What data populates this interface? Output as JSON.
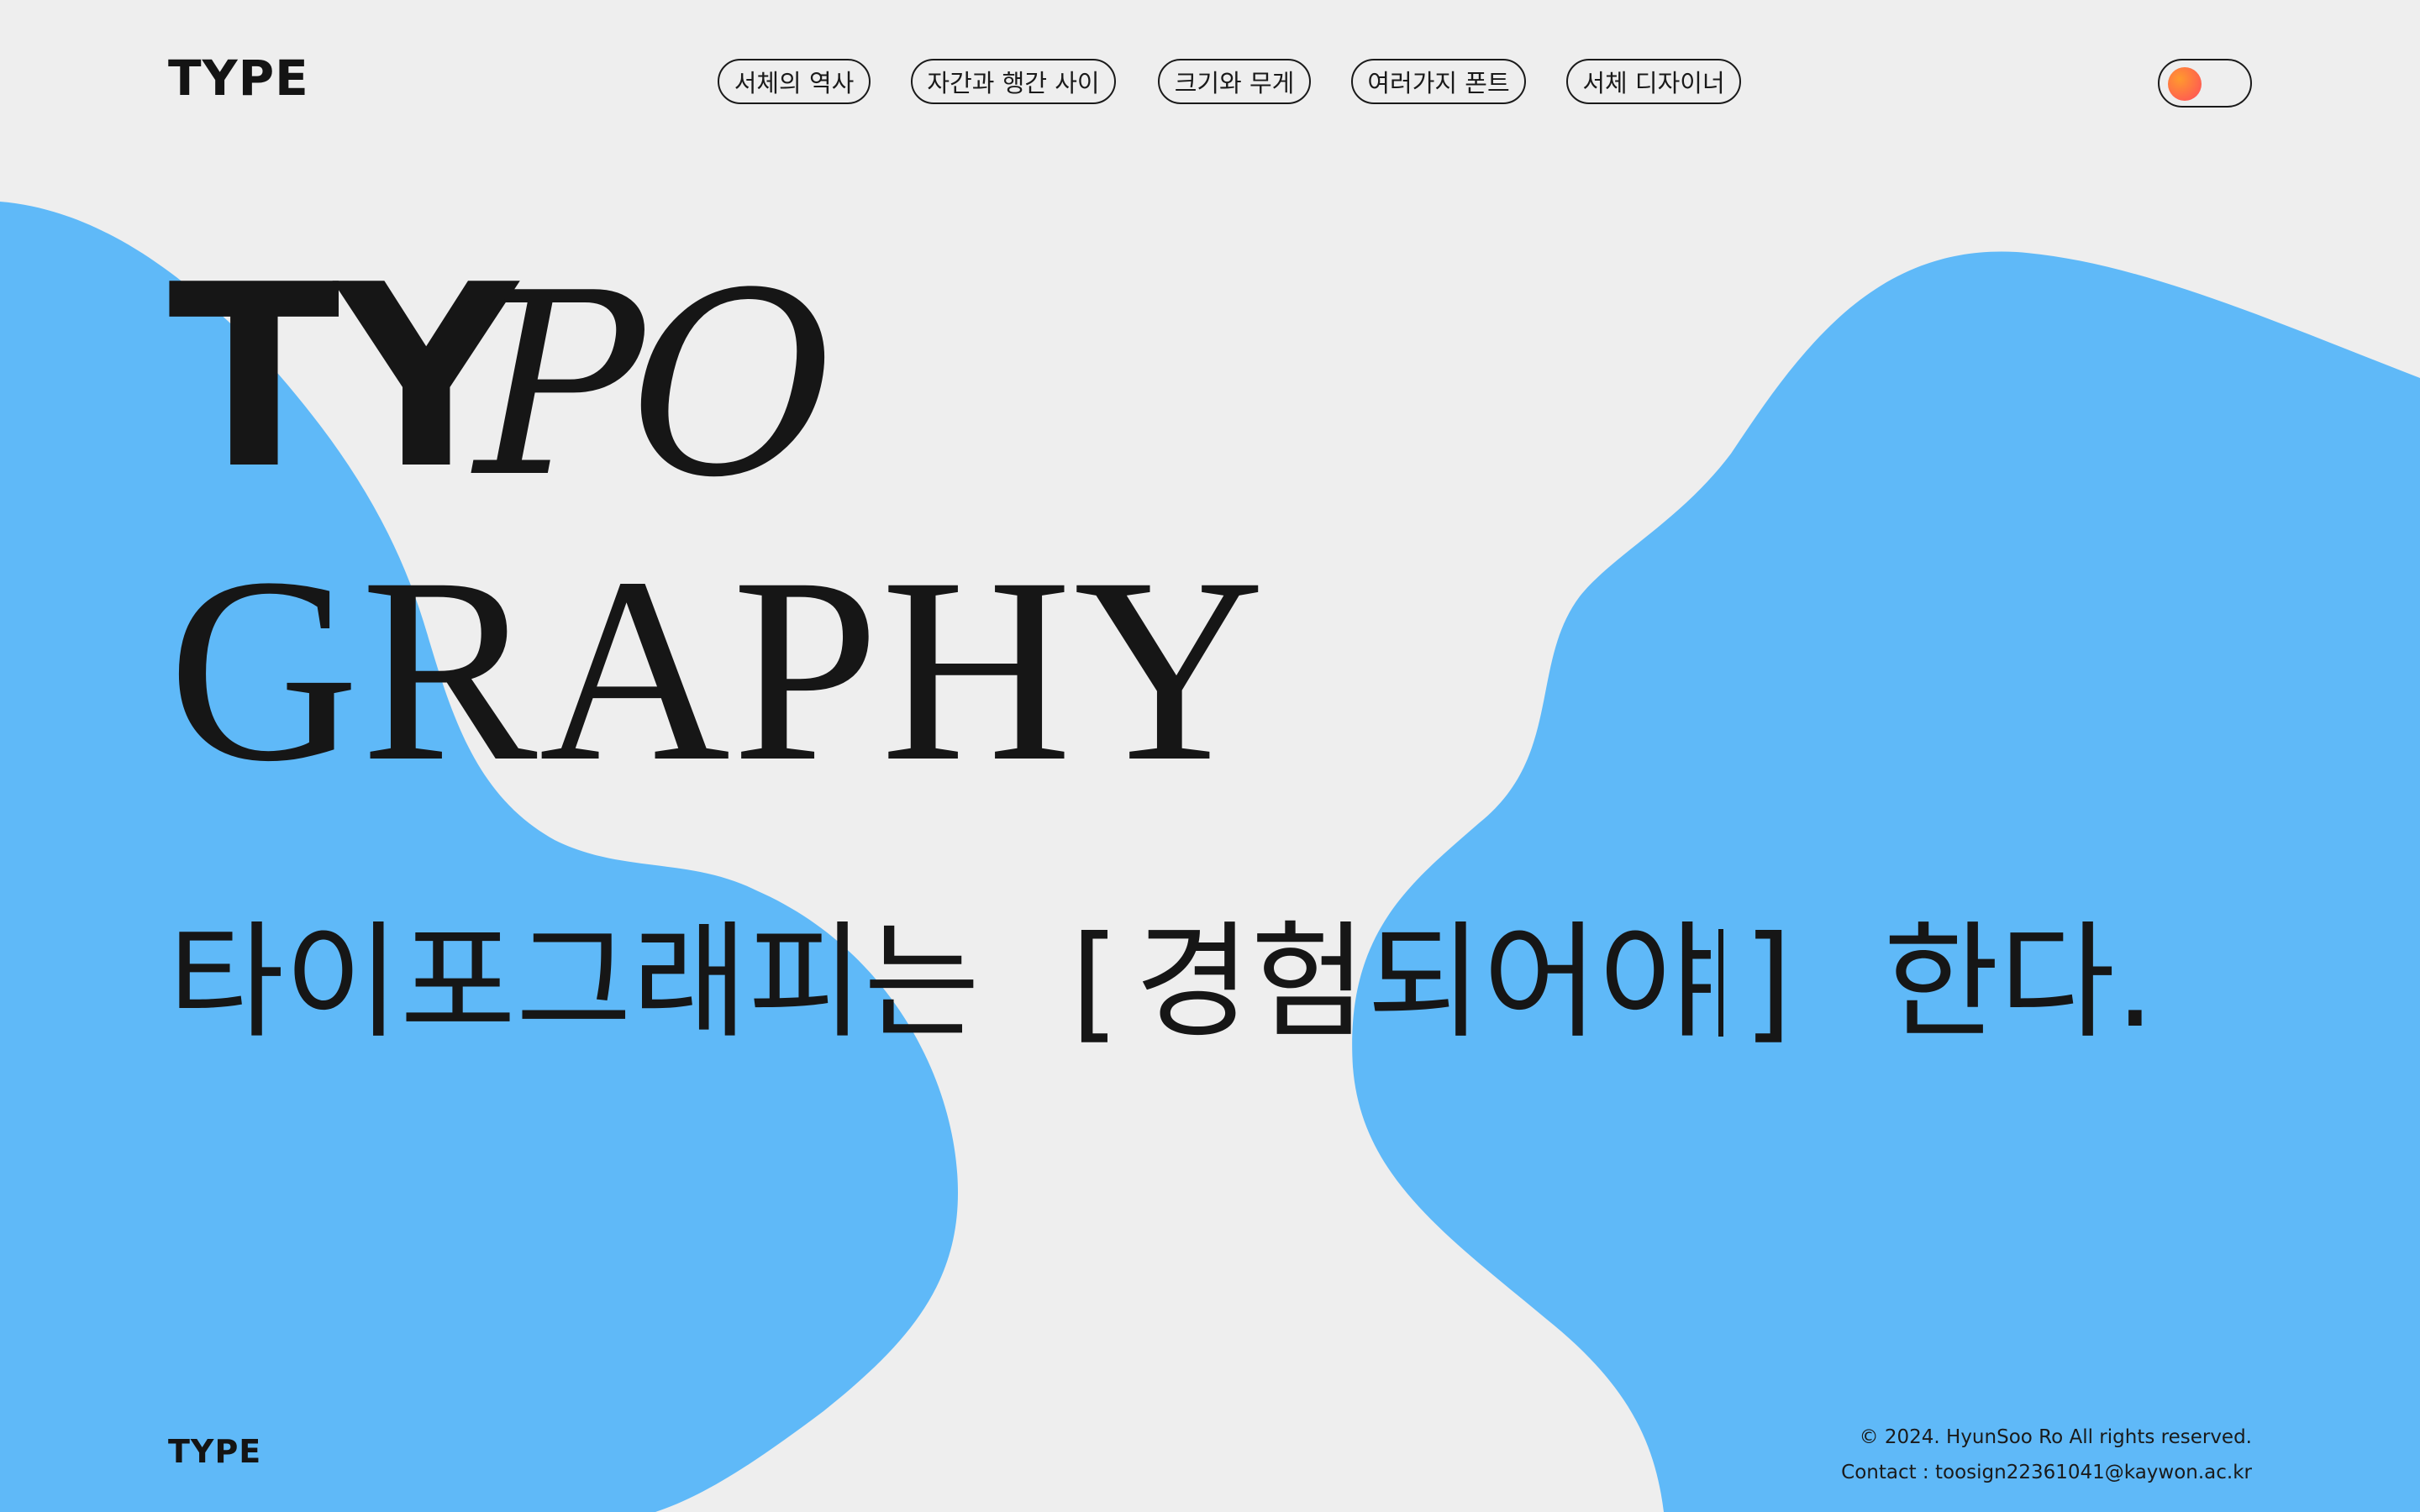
{
  "header": {
    "logo": "TYPE",
    "nav": [
      {
        "label": "서체의 역사"
      },
      {
        "label": "자간과 행간 사이"
      },
      {
        "label": "크기와 무게"
      },
      {
        "label": "여러가지 폰트"
      },
      {
        "label": "서체 디자이너"
      }
    ],
    "toggle_state": "off"
  },
  "hero": {
    "line1_sans": "TY",
    "line1_script": "PO",
    "line2": "GRAPHY"
  },
  "sentence": {
    "before": "타이포그래피는",
    "bracket_open": "[",
    "typed": "경험되어야",
    "bracket_close": "]",
    "after": "한다."
  },
  "footer": {
    "logo": "TYPE",
    "copyright": "© 2024. HyunSoo Ro All rights reserved.",
    "contact": "Contact : toosign22361041@kaywon.ac.kr"
  },
  "colors": {
    "background": "#eeeeee",
    "blob": "#5fb9f8",
    "text": "#161616",
    "toggle_knob": "#ff5a4a"
  },
  "icons": {
    "toggle": "toggle-switch-icon"
  }
}
